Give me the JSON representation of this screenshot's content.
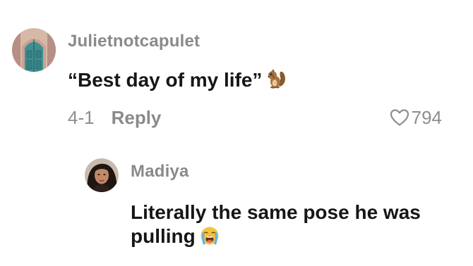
{
  "comment": {
    "username": "Julietnotcapulet",
    "text": "“Best day of my life”",
    "emoji": "chipmunk-icon",
    "date": "4-1",
    "reply_label": "Reply",
    "like_count": "794"
  },
  "reply": {
    "username": "Madiya",
    "text": "Literally the same pose he was pulling",
    "emoji": "loudly-crying-face-icon"
  },
  "colors": {
    "username": "#8a8a8a",
    "text": "#161616",
    "meta": "#8e8e8e",
    "door_teal": "#3f8f93",
    "crying_face": "#f5c33b"
  }
}
